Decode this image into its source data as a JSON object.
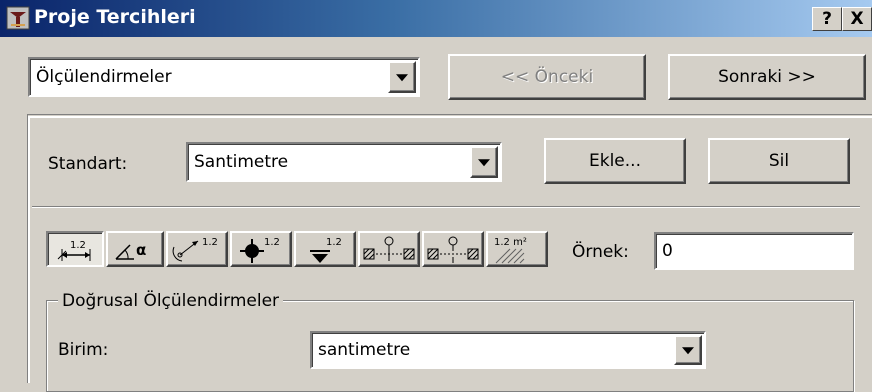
{
  "window": {
    "title": "Proje Tercihleri",
    "help_label": "?",
    "close_label": "X"
  },
  "nav": {
    "section_value": "Ölçülendirmeler",
    "prev_label": "<< Önceki",
    "next_label": "Sonraki >>"
  },
  "standard": {
    "label": "Standart:",
    "value": "Santimetre",
    "add_label": "Ekle...",
    "delete_label": "Sil"
  },
  "dimension_tools": {
    "items": [
      {
        "name": "linear-dimension",
        "label": "1.2"
      },
      {
        "name": "angular-dimension",
        "label": "α"
      },
      {
        "name": "radial-dimension",
        "label": "1.2"
      },
      {
        "name": "level-dimension",
        "label": "1.2"
      },
      {
        "name": "elevation-dimension",
        "label": "1.2"
      },
      {
        "name": "door-window-dimension",
        "label": ""
      },
      {
        "name": "sill-height-dimension",
        "label": ""
      },
      {
        "name": "area-dimension",
        "label": "1.2 m²"
      }
    ],
    "example_label": "Örnek:",
    "example_value": "0"
  },
  "linear_group": {
    "title": "Doğrusal Ölçülendirmeler",
    "unit_label": "Birim:",
    "unit_value": "santimetre"
  },
  "colors": {
    "titlebar_start": "#0a246a",
    "titlebar_end": "#a6caf0",
    "face": "#d4d0c8"
  }
}
